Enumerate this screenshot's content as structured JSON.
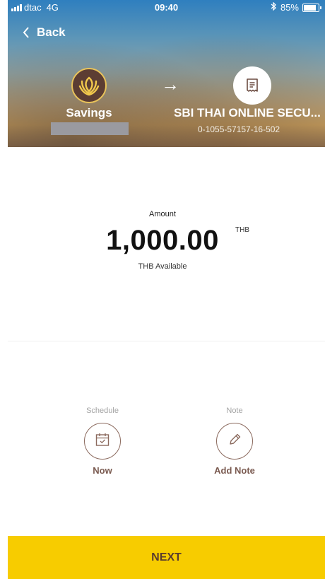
{
  "status_bar": {
    "carrier": "dtac",
    "network": "4G",
    "time": "09:40",
    "battery": "85%",
    "bluetooth_icon": "bluetooth-icon"
  },
  "nav": {
    "back_label": "Back"
  },
  "transfer": {
    "from": {
      "name": "Savings",
      "logo_icon": "bank-logo-icon"
    },
    "arrow": "→",
    "to": {
      "name": "SBI THAI ONLINE SECU...",
      "account_number": "0-1055-57157-16-502",
      "icon": "receipt-icon"
    }
  },
  "amount": {
    "label": "Amount",
    "value": "1,000.00",
    "currency": "THB",
    "available_label": "THB Available"
  },
  "options": {
    "schedule": {
      "title": "Schedule",
      "value": "Now",
      "icon": "calendar-icon"
    },
    "note": {
      "title": "Note",
      "value": "Add Note",
      "icon": "pencil-icon"
    }
  },
  "next_button": {
    "label": "NEXT"
  },
  "colors": {
    "accent_yellow": "#F7CC00",
    "brown_text": "#7A5A50",
    "logo_bg": "#5C3D33"
  }
}
